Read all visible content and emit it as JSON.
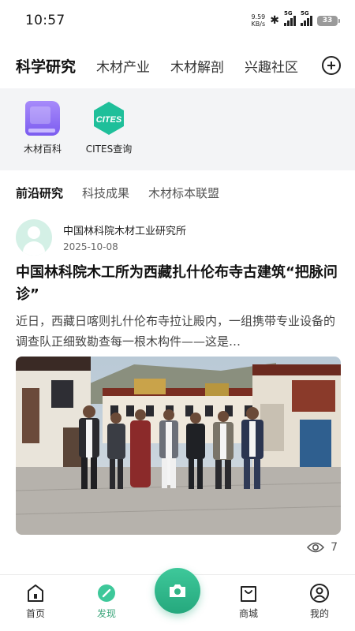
{
  "status": {
    "time": "10:57",
    "net_speed_value": "9.59",
    "net_speed_unit": "KB/s",
    "signal1": "5G",
    "signal2": "5G",
    "battery": "33"
  },
  "top_tabs": [
    {
      "label": "科学研究",
      "active": true
    },
    {
      "label": "木材产业",
      "active": false
    },
    {
      "label": "木材解剖",
      "active": false
    },
    {
      "label": "兴趣社区",
      "active": false
    }
  ],
  "shortcuts": [
    {
      "label": "木材百科",
      "icon": "book-icon"
    },
    {
      "label": "CITES查询",
      "icon": "cites-icon"
    }
  ],
  "cites_logo_text": "CITES",
  "sub_tabs": [
    {
      "label": "前沿研究",
      "active": true
    },
    {
      "label": "科技成果",
      "active": false
    },
    {
      "label": "木材标本联盟",
      "active": false
    }
  ],
  "post": {
    "author": "中国林科院木材工业研究所",
    "date": "2025-10-08",
    "title": "中国林科院木工所为西藏扎什伦布寺古建筑“把脉问诊”",
    "excerpt": "近日，西藏日喀则扎什伦布寺拉让殿内，一组携带专业设备的调查队正细致勘查每一根木构件——这是…",
    "views": "7"
  },
  "bottom_nav": [
    {
      "label": "首页",
      "icon": "home-icon",
      "active": false
    },
    {
      "label": "发现",
      "icon": "discover-icon",
      "active": true
    },
    {
      "label": "商城",
      "icon": "shop-icon",
      "active": false
    },
    {
      "label": "我的",
      "icon": "profile-icon",
      "active": false
    }
  ],
  "colors": {
    "accent": "#2fb485",
    "accent_light": "#b6ebd3",
    "shortcut_bg": "#f3f4f6"
  }
}
